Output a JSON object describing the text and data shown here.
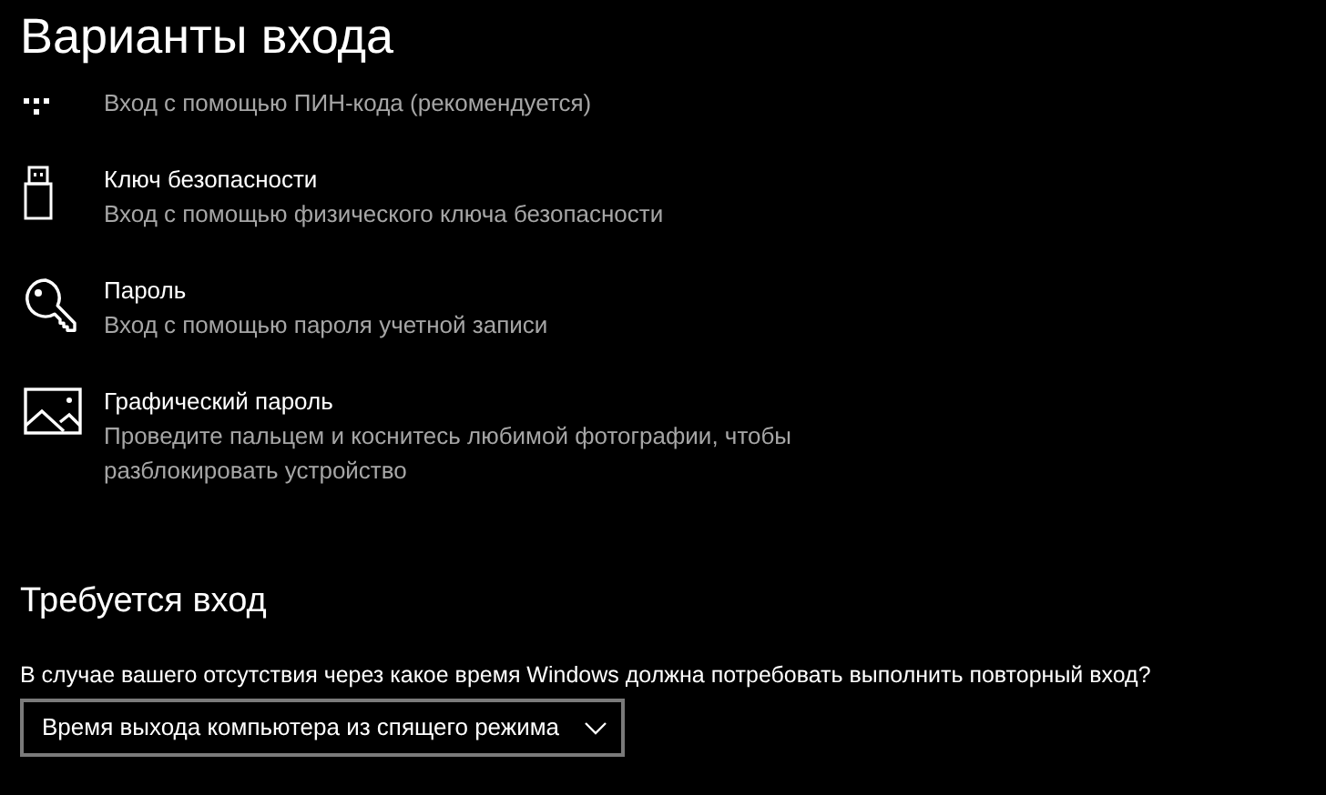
{
  "title": "Варианты входа",
  "options": [
    {
      "kind": "pin",
      "description": "Вход с помощью ПИН-кода (рекомендуется)"
    },
    {
      "kind": "key",
      "name": "Ключ безопасности",
      "description": "Вход с помощью физического ключа безопасности"
    },
    {
      "kind": "password",
      "name": "Пароль",
      "description": "Вход с помощью пароля учетной записи"
    },
    {
      "kind": "picture",
      "name": "Графический пароль",
      "description": "Проведите пальцем и коснитесь любимой фотографии, чтобы разблокировать устройство"
    }
  ],
  "require_signin": {
    "heading": "Требуется вход",
    "question": "В случае вашего отсутствия через какое время Windows должна потребовать выполнить повторный вход?",
    "dropdown": {
      "value": "Время выхода компьютера из спящего режима"
    }
  }
}
